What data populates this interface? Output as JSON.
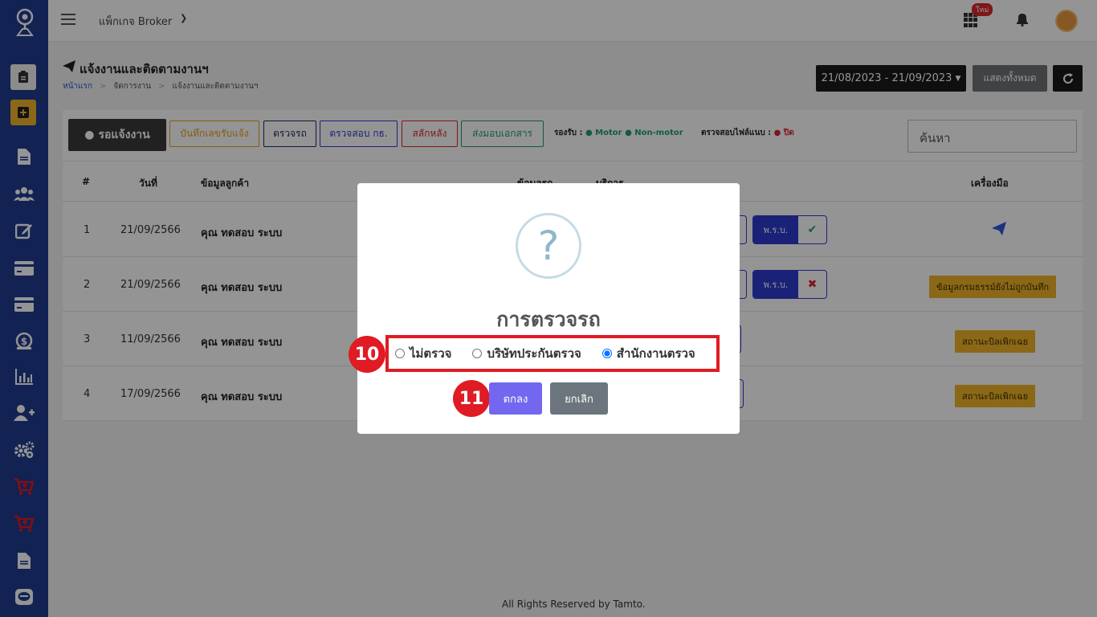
{
  "topbar": {
    "package_label": "แพ็กเกจ Broker",
    "new_badge": "ใหม่"
  },
  "header": {
    "title": "แจ้งงานและติดตามงานฯ",
    "breadcrumb": [
      "หน้าแรก",
      "จัดการงาน",
      "แจ้งงานและติดตามงานฯ"
    ],
    "date_range": "21/08/2023 - 21/09/2023",
    "show_all": "แสดงทั้งหมด"
  },
  "filters": {
    "waiting": "รอแจ้งงาน",
    "record_claim": "บันทึกเลขรับแจ้ง",
    "inspect_car": "ตรวจรถ",
    "check_kt": "ตรวจสอบ กธ.",
    "slip": "สลักหลัง",
    "deliver_docs": "ส่งมอบเอกสาร",
    "support_label": "รองรับ :",
    "motor": "Motor",
    "non_motor": "Non-motor",
    "attach_check_label": "ตรวจสอบไฟล์แนบ :",
    "attach_state": "ปิด",
    "search_placeholder": "ค้นหา"
  },
  "table": {
    "headers": {
      "num": "#",
      "date": "วันที่",
      "customer": "ข้อมูลลูกค้า",
      "car": "ข้อมูลรถ",
      "service": "บริการ",
      "tools": "เครื่องมือ"
    },
    "rows": [
      {
        "num": "1",
        "date": "21/09/2566",
        "customer": "คุณ ทดสอบ ระบบ",
        "prb": "พ.ร.บ.",
        "status": "✔",
        "tool": ""
      },
      {
        "num": "2",
        "date": "21/09/2566",
        "customer": "คุณ ทดสอบ ระบบ",
        "prb": "พ.ร.บ.",
        "status": "✖",
        "tool": "ข้อมูลกรมธรรม์ยังไม่ถูกบันทึก"
      },
      {
        "num": "3",
        "date": "11/09/2566",
        "customer": "คุณ ทดสอบ ระบบ",
        "tool": "สถานะบิลเพิกเฉย"
      },
      {
        "num": "4",
        "date": "17/09/2566",
        "customer": "คุณ ทดสอบ ระบบ",
        "tool": "สถานะบิลเพิกเฉย"
      }
    ]
  },
  "footer": "All Rights Reserved by Tamto.",
  "modal": {
    "icon": "?",
    "title": "การตรวจรถ",
    "options": [
      {
        "label": "ไม่ตรวจ",
        "checked": false
      },
      {
        "label": "บริษัทประกันตรวจ",
        "checked": false
      },
      {
        "label": "สำนักงานตรวจ",
        "checked": true
      }
    ],
    "ok": "ตกลง",
    "cancel": "ยกเลิก"
  },
  "markers": {
    "step_10": "10",
    "step_11": "11"
  },
  "colors": {
    "sidebar": "#1f3b8f",
    "accent": "#7367f0",
    "marker": "#e01b23",
    "prb": "#2d3ccf",
    "warning_tag": "#f0b429"
  }
}
